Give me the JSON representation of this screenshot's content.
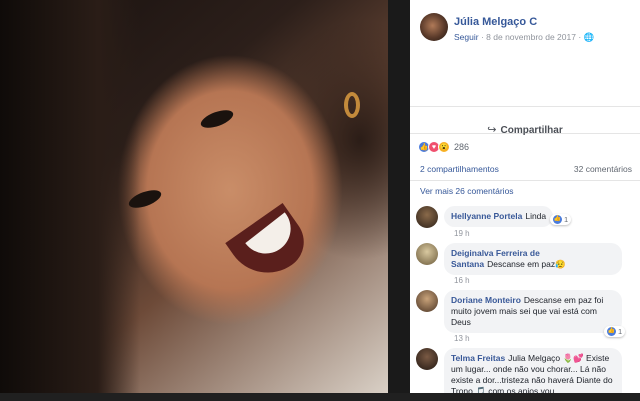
{
  "post": {
    "author": "Júlia Melgaço C",
    "follow_label": "Seguir",
    "date": "8 de novembro de 2017",
    "separator": "·",
    "globe_icon": "globe-icon",
    "share_label": "Compartilhar"
  },
  "reactions": {
    "count": "286",
    "icons": [
      "like-icon",
      "love-icon",
      "wow-icon"
    ],
    "colors": {
      "like": "#4a7bdc",
      "love": "#f0506e",
      "wow": "#f7b125"
    }
  },
  "stats": {
    "shares": "2 compartilhamentos",
    "comments": "32 comentários"
  },
  "more_comments": "Ver mais 26 comentários",
  "comments": [
    {
      "author": "Hellyanne Portela",
      "text": "Linda",
      "time": "19 h",
      "likes": "1"
    },
    {
      "author": "Deiginalva Ferreira de Santana",
      "text": "Descanse em paz😥",
      "time": "16 h"
    },
    {
      "author": "Doriane Monteiro",
      "text": "Descanse em paz foi muito jovem mais sei que vai está com Deus",
      "time": "13 h",
      "likes": "1"
    },
    {
      "author": "Telma Freitas",
      "text": "Julia Melgaço 🌷💕 Existe um lugar... onde não vou chorar... Lá não existe a dor...tristeza não haverá Diante do Trono 🎵 com os anjos vou"
    }
  ],
  "colors": {
    "link": "#365899",
    "panel_bg": "#ffffff",
    "bubble_bg": "#f2f3f5"
  }
}
